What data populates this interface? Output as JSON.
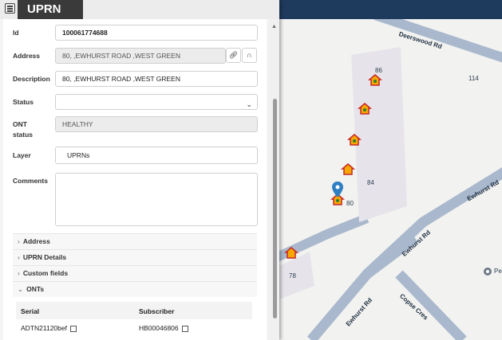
{
  "panel": {
    "title": "UPRN"
  },
  "form": {
    "id": {
      "label": "Id",
      "value": "100061774688"
    },
    "address": {
      "label": "Address",
      "value": "80, ,EWHURST ROAD ,WEST GREEN"
    },
    "description": {
      "label": "Description",
      "value": "80, ,EWHURST ROAD ,WEST GREEN"
    },
    "status": {
      "label": "Status",
      "value": ""
    },
    "ont_status": {
      "label": "ONT status",
      "value": "HEALTHY"
    },
    "layer": {
      "label": "Layer",
      "value": "UPRNs"
    },
    "comments": {
      "label": "Comments",
      "value": ""
    }
  },
  "sections": [
    "Address",
    "UPRN Details",
    "Custom fields",
    "ONTs"
  ],
  "onts": {
    "columns": [
      "Serial",
      "Subscriber"
    ],
    "rows": [
      {
        "serial": "ADTN21120bef",
        "subscriber": "HB00046806"
      }
    ]
  },
  "map": {
    "roads": [
      "Deerswood Rd",
      "Ewhurst Rd",
      "Ewhurst Rd",
      "Ewhurst Rd",
      "Copse Cres"
    ],
    "house_numbers": [
      "86",
      "114",
      "84",
      "80",
      "78"
    ],
    "poi_label": "Pe",
    "colors": {
      "road": "#a9b8cc",
      "building": "#e6e4ea",
      "marker_fill": "#f6a800",
      "marker_roof": "#c62828",
      "pin": "#2e7fc2"
    }
  }
}
